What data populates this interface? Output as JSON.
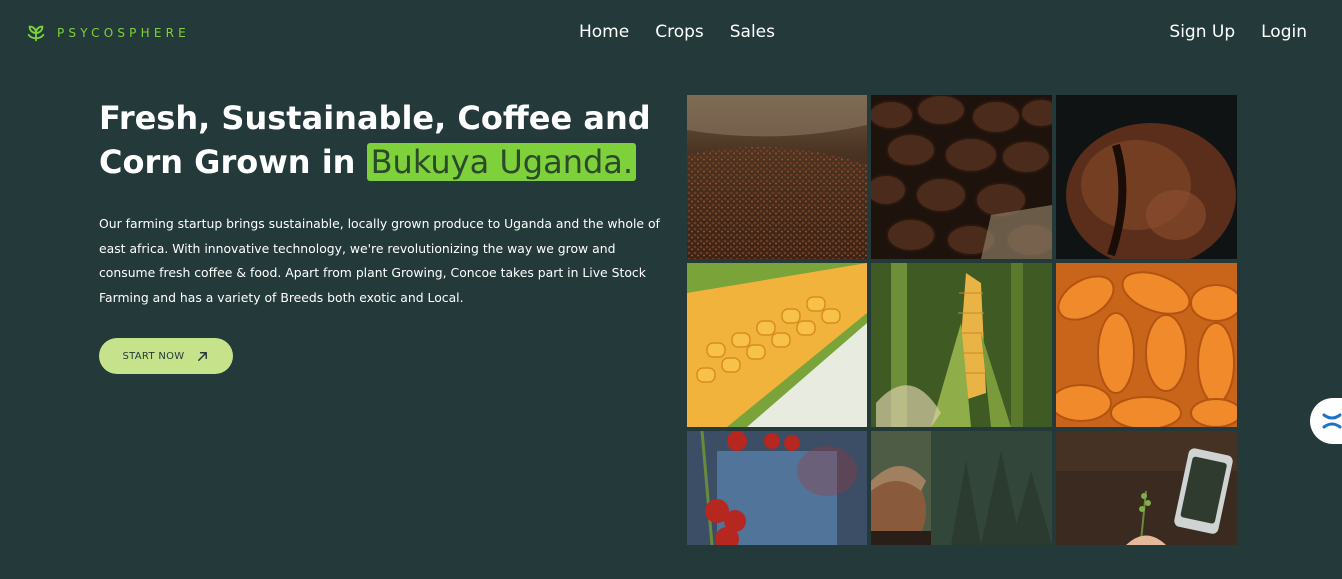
{
  "brand": {
    "name": "PSYCOSPHERE",
    "icon": "leaf-sprout-icon",
    "color": "#7fd13b"
  },
  "nav": {
    "center": [
      {
        "label": "Home"
      },
      {
        "label": "Crops"
      },
      {
        "label": "Sales"
      }
    ],
    "right": [
      {
        "label": "Sign Up"
      },
      {
        "label": "Login"
      }
    ]
  },
  "hero": {
    "title_line1": "Fresh, Sustainable, Coffee and",
    "title_line2_prefix": "Corn Grown in ",
    "title_highlight": "Bukuya Uganda.",
    "description": "Our farming startup brings sustainable, locally grown produce to Uganda and the whole of east africa. With innovative technology, we're revolutionizing the way we grow and consume fresh coffee & food. Apart from plant Growing, Concoe takes part in Live Stock Farming and has a variety of Breeds both exotic and Local.",
    "cta_label": "START NOW",
    "cta_icon": "arrow-up-right-icon"
  },
  "gallery": [
    {
      "subject": "ground coffee beans in burlap sack"
    },
    {
      "subject": "roasted coffee beans close-up"
    },
    {
      "subject": "single roasted coffee bean"
    },
    {
      "subject": "yellow corn cob in husk"
    },
    {
      "subject": "corn cob on stalk in field"
    },
    {
      "subject": "pile of orange corn cobs"
    },
    {
      "subject": "red coffee cherries on branch"
    },
    {
      "subject": "farmer overlooking forest"
    },
    {
      "subject": "hand holding seedling and phone"
    }
  ],
  "colors": {
    "background": "#24393a",
    "accent": "#7fd13b",
    "cta_background": "#c6e38b"
  },
  "floating_widget": {
    "icon": "chat-widget-icon"
  }
}
